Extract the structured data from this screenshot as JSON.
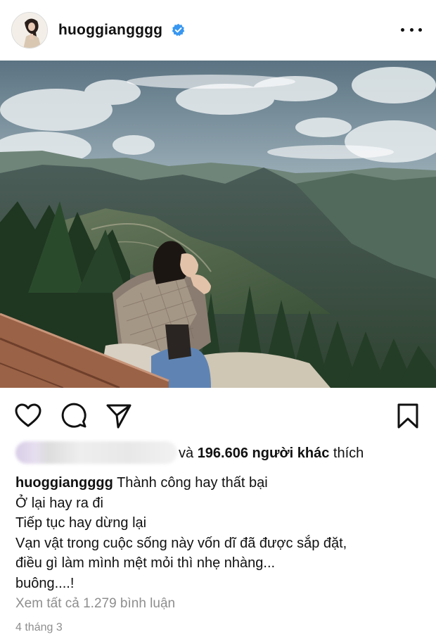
{
  "post": {
    "username": "huoggiangggg",
    "verified": true,
    "likes_prefix": "và ",
    "likes_count": "196.606",
    "likes_suffix_bold": " người khác",
    "likes_suffix": " thích",
    "caption_lines": [
      "Thành công hay thất bại",
      "Ở lại hay ra đi",
      "Tiếp tục hay dừng lại",
      "Vạn vật trong cuộc sống này vốn dĩ đã được sắp đặt,",
      "điều gì làm mình mệt mỏi thì nhẹ nhàng...",
      "buông....!"
    ],
    "view_comments": "Xem tất cả 1.279 bình luận",
    "date": "4 tháng 3"
  },
  "icons": {
    "verified": "verified-badge-icon",
    "more": "more-options-icon",
    "like": "heart-icon",
    "comment": "comment-icon",
    "share": "send-icon",
    "save": "bookmark-icon"
  },
  "colors": {
    "verified_blue": "#3897f0",
    "muted_text": "#8e8e8e"
  }
}
